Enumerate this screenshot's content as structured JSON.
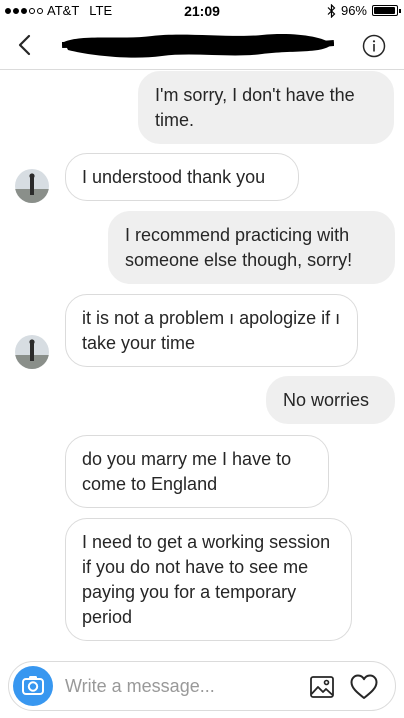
{
  "status_bar": {
    "carrier": "AT&T",
    "network": "LTE",
    "time": "21:09",
    "battery": "96%",
    "battery_level": 0.96,
    "signal_bars_filled": 3,
    "signal_bars_total": 5
  },
  "header": {
    "back_icon": "chevron-left-icon",
    "info_icon": "info-icon",
    "contact_name_redacted": true
  },
  "messages": [
    {
      "direction": "out",
      "text": "I'm sorry, I don't have the time."
    },
    {
      "direction": "in",
      "text": "I understood thank you"
    },
    {
      "direction": "out",
      "text": "I recommend practicing with someone else though, sorry!"
    },
    {
      "direction": "in",
      "text": "it is not a problem ı apologize if ı take your time"
    },
    {
      "direction": "out",
      "text": "No worries"
    },
    {
      "direction": "in",
      "text": "do you marry me I have to come to England"
    },
    {
      "direction": "in",
      "text": "I need to get a working session if you do not have to see me paying you for a temporary period"
    }
  ],
  "composer": {
    "placeholder": "Write a message...",
    "camera_icon": "camera-icon",
    "gallery_icon": "image-gallery-icon",
    "heart_icon": "heart-icon"
  },
  "colors": {
    "accent": "#3897f0",
    "bubble_outgoing": "#efefef",
    "bubble_incoming_border": "#dbdbdb",
    "text": "#262626"
  }
}
